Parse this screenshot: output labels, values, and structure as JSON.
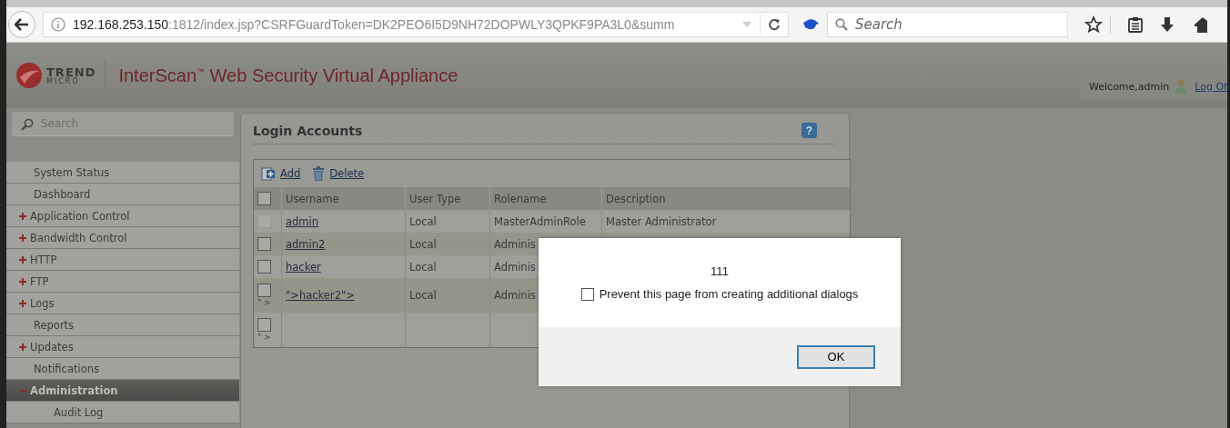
{
  "browser": {
    "url_host": "192.168.253.150",
    "url_rest": ":1812/index.jsp?CSRFGuardToken=DK2PEO6I5D9NH72DOPWLY3QPKF9PA3L0&summ",
    "search": {
      "placeholder": "Search"
    }
  },
  "header": {
    "logo_top": "TREND",
    "logo_bottom": "MICRO",
    "title": "InterScan$^{™}$ Web Security Virtual Appliance",
    "welcome": "Welcome,admin",
    "logout": "Log Of"
  },
  "sidebar": {
    "search": {
      "placeholder": "Search"
    },
    "items": [
      {
        "label": "System Status",
        "kind": "leaf",
        "selected": false
      },
      {
        "label": "Dashboard",
        "kind": "leaf",
        "selected": false
      },
      {
        "label": "Application Control",
        "kind": "group",
        "expanded": false,
        "selected": false
      },
      {
        "label": "Bandwidth Control",
        "kind": "group",
        "expanded": false,
        "selected": false
      },
      {
        "label": "HTTP",
        "kind": "group",
        "expanded": false,
        "selected": false
      },
      {
        "label": "FTP",
        "kind": "group",
        "expanded": false,
        "selected": false
      },
      {
        "label": "Logs",
        "kind": "group",
        "expanded": false,
        "selected": false
      },
      {
        "label": "Reports",
        "kind": "leaf",
        "selected": false
      },
      {
        "label": "Updates",
        "kind": "group",
        "expanded": false,
        "selected": false
      },
      {
        "label": "Notifications",
        "kind": "leaf",
        "selected": false
      },
      {
        "label": "Administration",
        "kind": "group",
        "expanded": true,
        "selected": true,
        "children": [
          {
            "label": "Audit Log",
            "kind": "leaf",
            "selected": false
          }
        ]
      }
    ]
  },
  "panel": {
    "title": "Login Accounts",
    "help": "?",
    "toolbar": [
      "Add",
      "Delete"
    ],
    "table": {
      "select_all": {
        "checked": false
      },
      "columns": [
        "Username",
        "User Type",
        "Rolename",
        "Description"
      ],
      "rows": [
        {
          "checked": false,
          "disabled": true,
          "username": "admin",
          "user_type": "Local",
          "rolename": "MasterAdminRole",
          "description": "Master Administrator"
        },
        {
          "checked": false,
          "disabled": false,
          "username": "admin2",
          "user_type": "Local",
          "rolename": "Adminis"
        },
        {
          "checked": false,
          "disabled": false,
          "username": "hacker",
          "user_type": "Local",
          "rolename": "Adminis"
        },
        {
          "checked": false,
          "disabled": false,
          "note": "\" >",
          "username": "\">hacker2\">",
          "user_type": "Local",
          "rolename": "Adminis"
        },
        {
          "checked": false,
          "disabled": false,
          "note": "\" >"
        }
      ]
    }
  },
  "dialog": {
    "message": "111",
    "option": {
      "label": "Prevent this page from creating additional dialogs",
      "checked": false
    },
    "button": "OK"
  }
}
